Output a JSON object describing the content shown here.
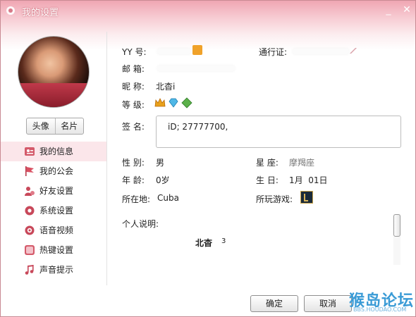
{
  "window": {
    "title": "我的设置",
    "minimize": "_",
    "close": "✕"
  },
  "sidebar": {
    "buttons": {
      "avatar": "头像",
      "card": "名片"
    },
    "items": [
      {
        "label": "我的信息",
        "icon": "profile-card-icon"
      },
      {
        "label": "我的公会",
        "icon": "flag-icon"
      },
      {
        "label": "好友设置",
        "icon": "friends-gear-icon"
      },
      {
        "label": "系统设置",
        "icon": "gear-icon"
      },
      {
        "label": "语音视频",
        "icon": "webcam-icon"
      },
      {
        "label": "热键设置",
        "icon": "keyboard-icon"
      },
      {
        "label": "声音提示",
        "icon": "music-note-icon"
      }
    ]
  },
  "profile": {
    "yy_label": "YY 号:",
    "pass_label": "通行证:",
    "email_label": "邮 箱:",
    "nickname_label": "昵 称:",
    "nickname_value": "北杳i",
    "level_label": "等 级:",
    "signature_label": "签 名:",
    "signature_value": "iD; 27777700,",
    "gender_label": "性 别:",
    "gender_value": "男",
    "zodiac_label": "星 座:",
    "zodiac_value": "摩羯座",
    "age_label": "年 龄:",
    "age_value": "0岁",
    "birthday_label": "生 日:",
    "birthday_value": "1月  01日",
    "location_label": "所在地:",
    "location_value": "Cuba",
    "games_label": "所玩游戏:",
    "bio_label": "个人说明:",
    "bio_name": "北杳",
    "bio_num": "3"
  },
  "footer": {
    "ok": "确定",
    "cancel": "取消"
  },
  "watermark": {
    "text": "猴岛论坛",
    "url": "BBS.HOUDAO.COM"
  },
  "colors": {
    "title_gradient": "#f0a6b3",
    "active_item": "#fbe6ea",
    "accent": "#c83c4c"
  }
}
